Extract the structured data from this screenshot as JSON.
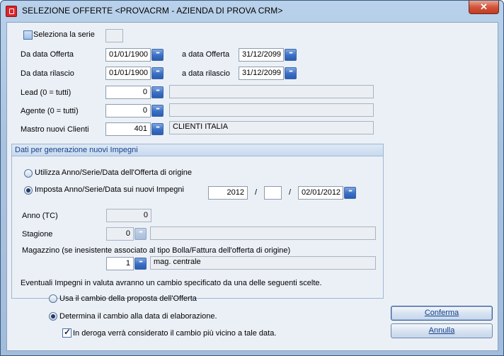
{
  "window": {
    "title": "SELEZIONE OFFERTE <PROVACRM - AZIENDA DI PROVA CRM>",
    "close_label": "✕"
  },
  "form": {
    "series": {
      "label": "Seleziona la serie",
      "checked": false,
      "value": ""
    },
    "from_offer_date": {
      "label": "Da data Offerta",
      "value": "01/01/1900"
    },
    "to_offer_date": {
      "label": "a data Offerta",
      "value": "31/12/2099"
    },
    "from_release_date": {
      "label": "Da data rilascio",
      "value": "01/01/1900"
    },
    "to_release_date": {
      "label": "a data rilascio",
      "value": "31/12/2099"
    },
    "lead": {
      "label": "Lead (0 = tutti)",
      "value": "0",
      "description": ""
    },
    "agent": {
      "label": "Agente (0 = tutti)",
      "value": "0",
      "description": ""
    },
    "new_clients_master": {
      "label": "Mastro nuovi Clienti",
      "value": "401",
      "description": "CLIENTI ITALIA"
    }
  },
  "group": {
    "title": "Dati per generazione nuovi Impegni",
    "radio_origin": {
      "label": "Utilizza Anno/Serie/Data dell'Offerta di origine",
      "selected": false
    },
    "radio_new": {
      "label": "Imposta Anno/Serie/Data sui nuovi Impegni",
      "selected": true
    },
    "year": "2012",
    "separator1": "/",
    "serie": "",
    "separator2": "/",
    "date": "02/01/2012",
    "anno_tc": {
      "label": "Anno (TC)",
      "value": "0"
    },
    "stagione": {
      "label": "Stagione",
      "value": "0",
      "description": ""
    },
    "magazzino": {
      "label": "Magazzino (se inesistente associato al tipo Bolla/Fattura dell'offerta di origine)",
      "value": "1",
      "description": "mag. centrale"
    }
  },
  "currency": {
    "intro": "Eventuali Impegni in valuta avranno un cambio specificato da una delle seguenti scelte.",
    "radio_offer_rate": {
      "label": "Usa il cambio della proposta dell'Offerta",
      "selected": false
    },
    "radio_date_rate": {
      "label": "Determina il cambio alla data di elaborazione.",
      "selected": true
    },
    "nearest_rate": {
      "label": "In deroga verrà considerato il cambio più vicino a tale data.",
      "checked": true
    }
  },
  "buttons": {
    "confirm": "Conferma",
    "cancel": "Annulla"
  }
}
